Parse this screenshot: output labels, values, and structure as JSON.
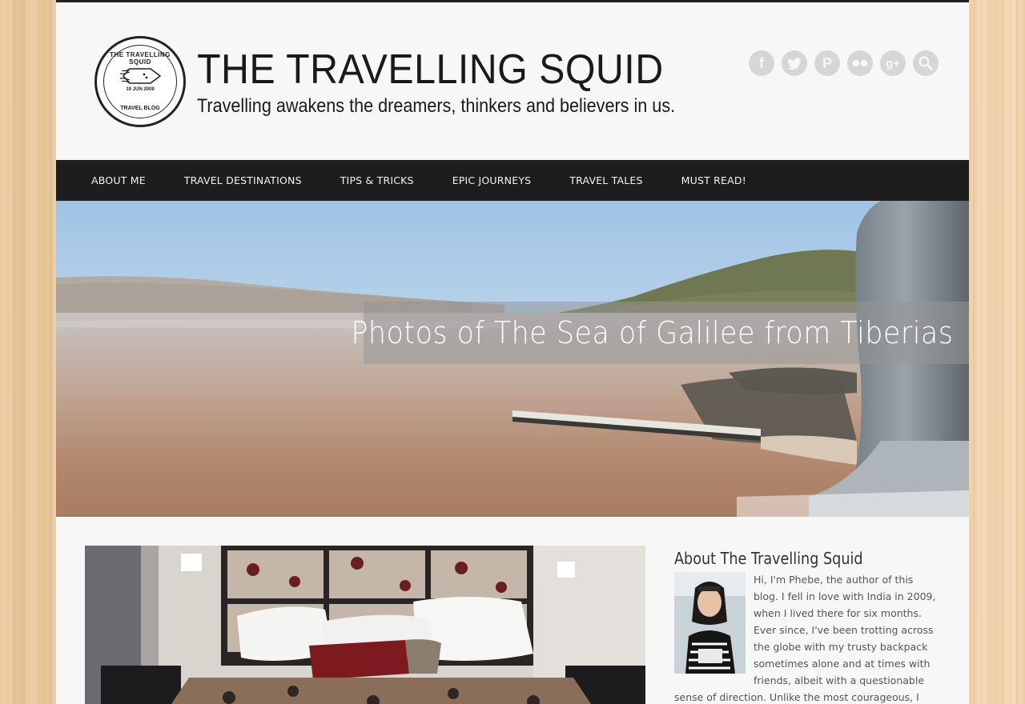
{
  "header": {
    "site_title": "THE TRAVELLING SQUID",
    "tagline": "Travelling awakens the dreamers, thinkers and believers in us.",
    "badge": {
      "top_text": "THE TRAVELLING SQUID",
      "date": "19 JUN 2009",
      "bottom_text": "TRAVEL BLOG"
    },
    "social": [
      {
        "name": "facebook-icon",
        "glyph": "f"
      },
      {
        "name": "twitter-icon",
        "glyph": "t"
      },
      {
        "name": "pinterest-icon",
        "glyph": "P"
      },
      {
        "name": "flickr-icon",
        "glyph": "••"
      },
      {
        "name": "google-plus-icon",
        "glyph": "g+"
      },
      {
        "name": "search-icon",
        "glyph": "⚲"
      }
    ]
  },
  "nav": {
    "items": [
      "ABOUT ME",
      "TRAVEL DESTINATIONS",
      "TIPS & TRICKS",
      "EPIC JOURNEYS",
      "TRAVEL TALES",
      "MUST READ!"
    ]
  },
  "hero": {
    "title": "Photos of The Sea of Galilee from Tiberias"
  },
  "sidebar": {
    "widget_title": "About The Travelling Squid",
    "about_text": "Hi, I'm Phebe, the author of this blog. I fell in love with India in 2009, when I lived there for six months. Ever since, I've been trotting across the globe with my trusty backpack sometimes alone and at times with friends, albeit with a questionable sense of direction. Unlike the most courageous, I haven't sold my belongings to"
  },
  "colors": {
    "nav_bg": "#1d1d1d",
    "page_bg": "#f7f7f7",
    "social_icon": "#d6d6d6",
    "wood": "#e8c9a0"
  }
}
